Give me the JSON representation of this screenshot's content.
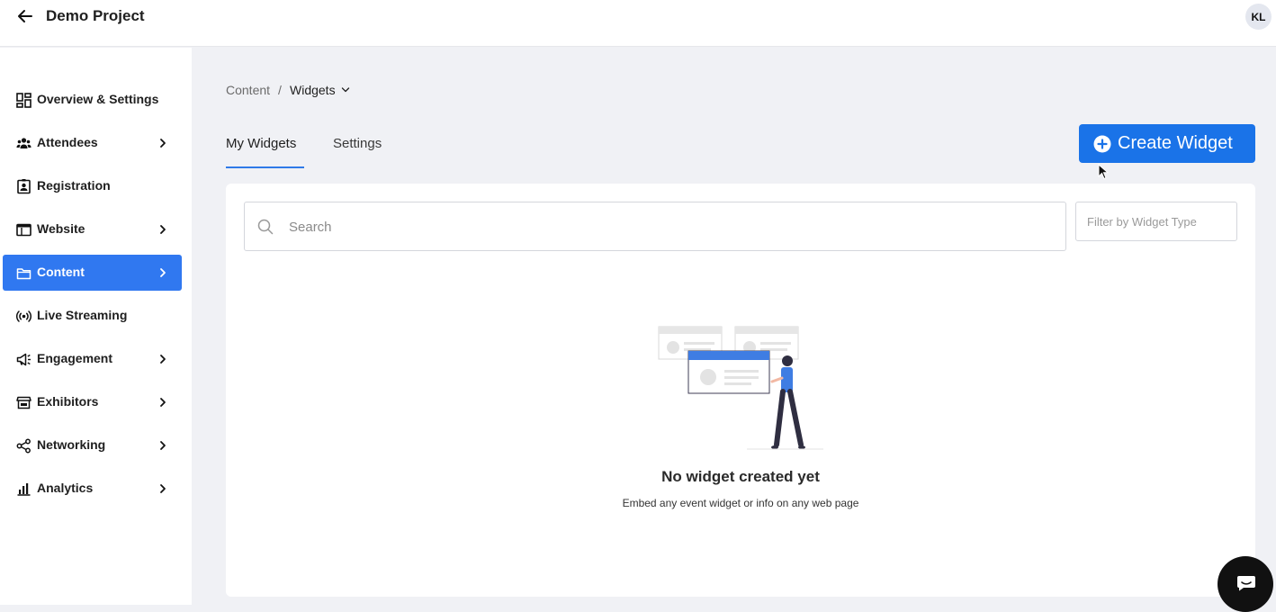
{
  "header": {
    "project_title": "Demo Project",
    "user_initials": "KL"
  },
  "sidebar": {
    "items": [
      {
        "label": "Overview & Settings",
        "icon": "grid-icon",
        "has_chevron": false,
        "active": false
      },
      {
        "label": "Attendees",
        "icon": "people-icon",
        "has_chevron": true,
        "active": false
      },
      {
        "label": "Registration",
        "icon": "id-card-icon",
        "has_chevron": false,
        "active": false
      },
      {
        "label": "Website",
        "icon": "browser-icon",
        "has_chevron": true,
        "active": false
      },
      {
        "label": "Content",
        "icon": "folder-icon",
        "has_chevron": true,
        "active": true
      },
      {
        "label": "Live Streaming",
        "icon": "broadcast-icon",
        "has_chevron": false,
        "active": false
      },
      {
        "label": "Engagement",
        "icon": "megaphone-icon",
        "has_chevron": true,
        "active": false
      },
      {
        "label": "Exhibitors",
        "icon": "store-icon",
        "has_chevron": true,
        "active": false
      },
      {
        "label": "Networking",
        "icon": "share-icon",
        "has_chevron": true,
        "active": false
      },
      {
        "label": "Analytics",
        "icon": "bar-chart-icon",
        "has_chevron": true,
        "active": false
      }
    ]
  },
  "breadcrumb": {
    "parent": "Content",
    "separator": "/",
    "current": "Widgets"
  },
  "tabs": [
    {
      "label": "My Widgets",
      "active": true
    },
    {
      "label": "Settings",
      "active": false
    }
  ],
  "actions": {
    "create_label": "Create Widget"
  },
  "search": {
    "placeholder": "Search",
    "value": ""
  },
  "filter": {
    "placeholder": "Filter by Widget Type"
  },
  "empty_state": {
    "title": "No widget created yet",
    "subtitle": "Embed any event widget or info on any web page"
  },
  "colors": {
    "accent": "#1a73e8",
    "active_nav": "#3078f0",
    "background": "#f0f1f5"
  }
}
